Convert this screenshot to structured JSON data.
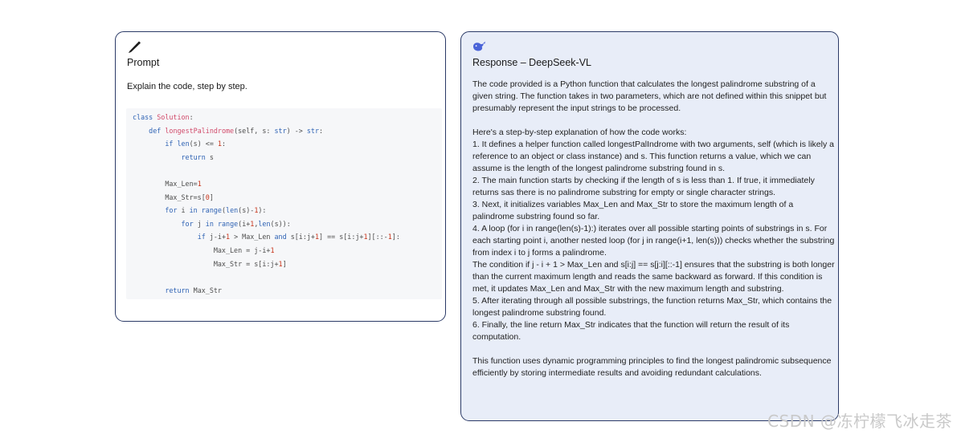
{
  "prompt": {
    "title": "Prompt",
    "text": "Explain the code, step by step.",
    "icon": "pen-icon",
    "code_lines": [
      "class Solution:",
      "    def longestPalindrome(self, s: str) -> str:",
      "        if len(s) <= 1:",
      "            return s",
      "",
      "        Max_Len=1",
      "        Max_Str=s[0]",
      "        for i in range(len(s)-1):",
      "            for j in range(i+1,len(s)):",
      "                if j-i+1 > Max_Len and s[i:j+1] == s[i:j+1][::-1]:",
      "                    Max_Len = j-i+1",
      "                    Max_Str = s[i:j+1]",
      "",
      "        return Max_Str"
    ]
  },
  "response": {
    "title": "Response – DeepSeek-VL",
    "icon": "whale-icon",
    "paragraphs": [
      "The code provided is a Python function that calculates the longest palindrome substring of a given string. The function takes in two parameters, which are not defined within this snippet but presumably represent the input strings to be processed.",
      "",
      "Here's a step-by-step explanation of how the code works:",
      "1. It defines a helper function called longestPalIndrome with two arguments, self (which is likely a reference to an object or class instance) and s. This function returns a value, which we can assume is the length of the longest palindrome substring found in s.",
      "2. The main function starts by checking if the length of s is less than 1. If true, it immediately returns sas there is no palindrome substring for empty or single character strings.",
      "3. Next, it initializes variables Max_Len and Max_Str to store the maximum length of a palindrome substring found so far.",
      "4. A loop (for i in range(len(s)-1):) iterates over all possible starting points of substrings in s. For each starting point i, another nested loop (for j in range(i+1, len(s))) checks whether the substring from index i to j forms a palindrome.",
      "The condition if j - i + 1 > Max_Len and s[i:j] == s[j:i][::-1] ensures that the substring is both longer than the current maximum length and reads the same backward as forward. If this condition is met, it updates Max_Len and Max_Str with the new maximum length and substring.",
      "5. After iterating through all possible substrings, the function returns Max_Str, which contains the longest palindrome substring found.",
      "6. Finally, the line return Max_Str indicates that the function will return the result of its computation.",
      "",
      "This function uses dynamic programming principles to find the longest palindromic subsequence efficiently by storing intermediate results and avoiding redundant calculations."
    ]
  },
  "watermark": "CSDN @冻柠檬飞冰走茶",
  "colors": {
    "border": "#2b3a67",
    "response_bg": "#e8edf8",
    "code_bg": "#f6f7f9",
    "keyword": "#2f63b4",
    "class_name": "#d14a6a",
    "number": "#c8341a"
  }
}
